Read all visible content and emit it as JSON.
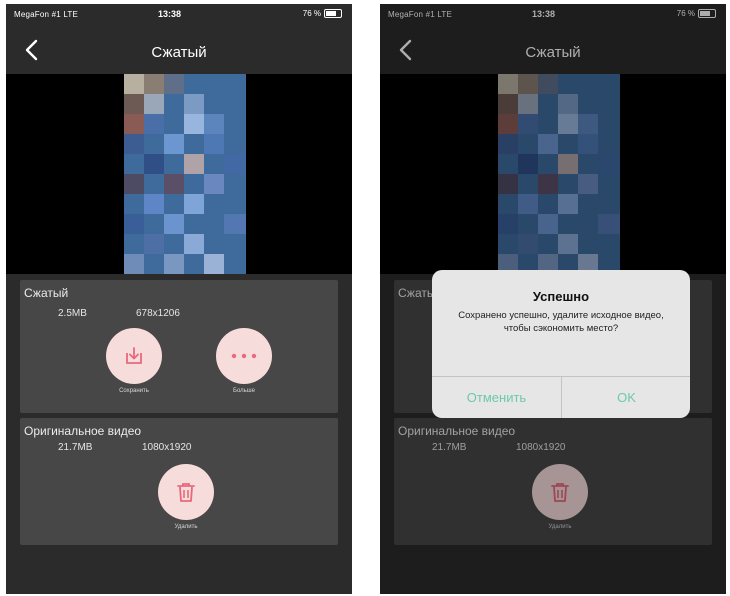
{
  "colors": {
    "screen_bg": "#2b2b2b",
    "card_bg": "#474747",
    "accent_pink": "#e8697c",
    "button_bg": "#f7dcdc",
    "dialog_button": "#6ec9a6"
  },
  "status_bar": {
    "carrier": "MegaFon #1",
    "network": "LTE",
    "time": "13:38",
    "battery": "76 %"
  },
  "nav": {
    "title": "Сжатый",
    "back_icon": "chevron-left-icon"
  },
  "compressed": {
    "title": "Сжатый",
    "size": "2.5MB",
    "resolution": "678x1206",
    "save_label": "Сохранить",
    "more_label": "Больше",
    "save_icon": "download-icon",
    "more_icon": "more-dots-icon"
  },
  "original": {
    "title": "Оригинальное видео",
    "size": "21.7MB",
    "resolution": "1080x1920",
    "delete_label": "Удалить",
    "delete_icon": "trash-icon"
  },
  "dialog": {
    "title": "Успешно",
    "message": "Сохранено успешно, удалите исходное видео, чтобы сэкономить место?",
    "cancel": "Отменить",
    "ok": "OK"
  }
}
